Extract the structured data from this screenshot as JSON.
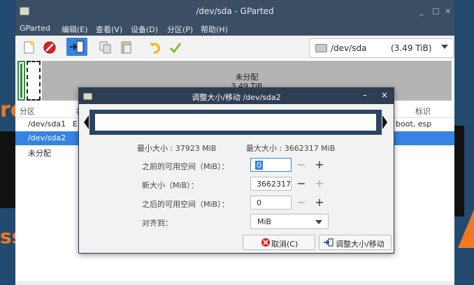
{
  "window": {
    "title": "/dev/sda - GParted",
    "controls": [
      "_",
      "□",
      "×"
    ]
  },
  "menu": [
    "GParted",
    "编辑(E)",
    "查看(V)",
    "设备(D)",
    "分区(P)",
    "帮助(H)"
  ],
  "toolbar": {
    "buttons": [
      "new-icon",
      "delete-icon",
      "resize-move-icon",
      "copy-icon",
      "paste-icon",
      "undo-icon",
      "apply-icon"
    ]
  },
  "device_selector": {
    "name": "/dev/sda",
    "size": "(3.49 TiB)"
  },
  "disk_map": {
    "unallocated_label": "未分配",
    "unallocated_size": "3.49 TiB"
  },
  "partition_list": {
    "headers": [
      "分区",
      "名",
      "标识"
    ],
    "rows": [
      {
        "partition": "/dev/sda1",
        "name": "E",
        "flags": "boot, esp"
      },
      {
        "partition": "/dev/sda2",
        "name": "",
        "flags": ""
      },
      {
        "partition": "未分配",
        "name": "",
        "flags": ""
      }
    ],
    "selected_index": 1
  },
  "dialog": {
    "title": "调整大小/移动 /dev/sda2",
    "min_size": "最小大小 : 37923 MiB",
    "max_size": "最大大小 : 3662317 MiB",
    "fields": [
      {
        "label": "之前的可用空间（MiB）：",
        "value": "0"
      },
      {
        "label": "新大小（MiB）：",
        "value": "3662317"
      },
      {
        "label": "之后的可用空间（MiB）：",
        "value": "0"
      }
    ],
    "align_label": "对齐到：",
    "align_value": "MiB",
    "cancel_label": "取消(C)",
    "resize_label": "调整大小/移动"
  },
  "colors": {
    "titlebar": "#3b4e63",
    "selection": "#3584e4",
    "partition_green": "#2a8f3a",
    "unallocated": "#b4b4b4",
    "resizer_bar": "#2a4564"
  }
}
